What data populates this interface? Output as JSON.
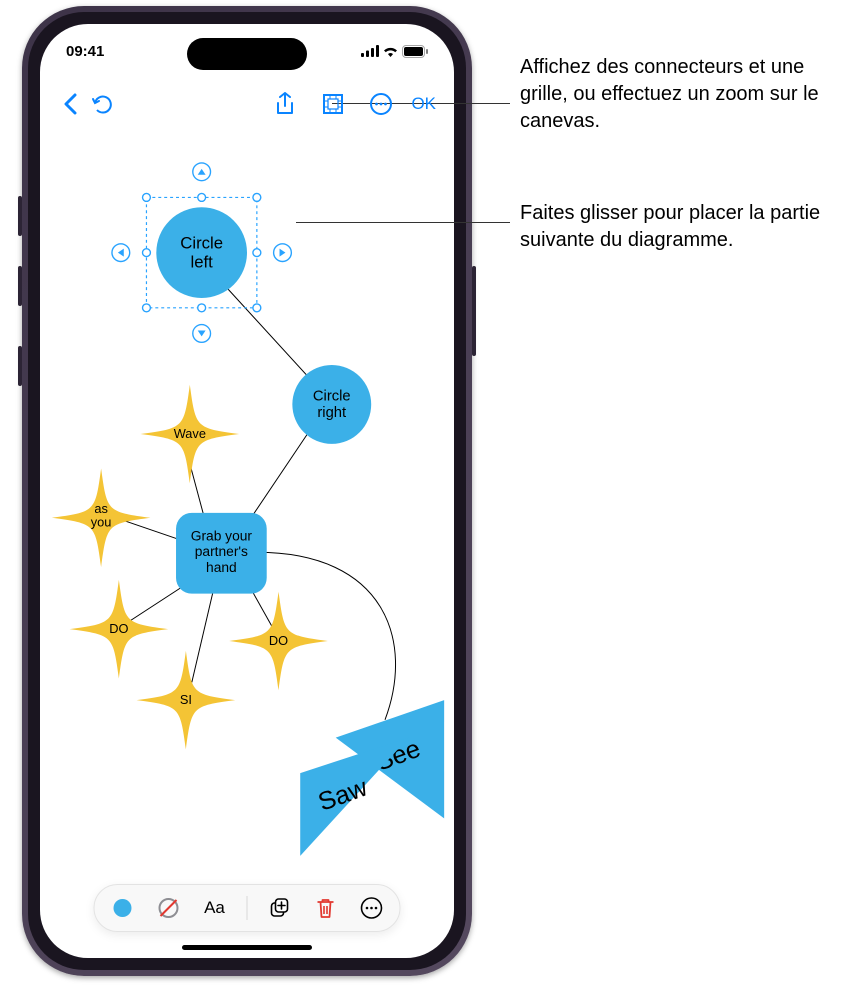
{
  "status": {
    "time": "09:41"
  },
  "toolbar": {
    "ok": "OK"
  },
  "shapes": {
    "circle_left": "Circle\nleft",
    "circle_right": "Circle\nright",
    "grab": "Grab your\npartner's\nhand",
    "wave": "Wave",
    "as_you": "as\nyou",
    "do1": "DO",
    "si": "SI",
    "do2": "DO",
    "see": "See",
    "saw": "Saw"
  },
  "bottom": {
    "font_label": "Aa"
  },
  "callouts": {
    "c1": "Affichez des connecteurs et une grille, ou effectuez un zoom sur le canevas.",
    "c2": "Faites glisser pour placer la partie suivante du diagramme."
  },
  "colors": {
    "accent": "#0a84ff",
    "cyan_fill": "#3bb0e8",
    "yellow": "#f4c435",
    "selection": "#29a3ff",
    "red": "#e2382f"
  }
}
